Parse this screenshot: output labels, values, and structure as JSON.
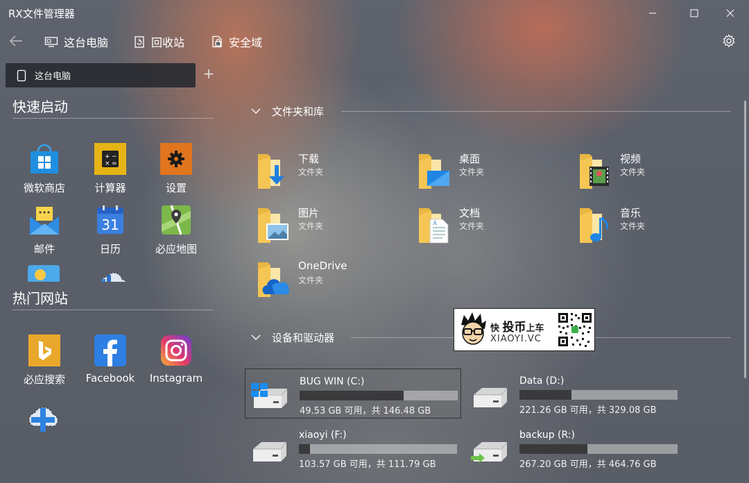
{
  "window": {
    "title": "RX文件管理器"
  },
  "toolbar": {
    "this_pc": "这台电脑",
    "recycle_bin": "回收站",
    "secure_zone": "安全域"
  },
  "tabs": [
    {
      "label": "这台电脑"
    }
  ],
  "sidebar": {
    "quick_launch_title": "快速启动",
    "apps": [
      {
        "label": "微软商店",
        "icon": "store-icon"
      },
      {
        "label": "计算器",
        "icon": "calculator-icon"
      },
      {
        "label": "设置",
        "icon": "settings-icon"
      },
      {
        "label": "邮件",
        "icon": "mail-icon"
      },
      {
        "label": "日历",
        "icon": "calendar-icon"
      },
      {
        "label": "必应地图",
        "icon": "maps-icon"
      }
    ],
    "calendar_day": "31",
    "hot_sites_title": "热门网站",
    "sites": [
      {
        "label": "必应搜索",
        "icon": "bing-icon"
      },
      {
        "label": "Facebook",
        "icon": "facebook-icon"
      },
      {
        "label": "Instagram",
        "icon": "instagram-icon"
      }
    ]
  },
  "main": {
    "folders_title": "文件夹和库",
    "folders": [
      {
        "name": "下载",
        "sub": "文件夹"
      },
      {
        "name": "桌面",
        "sub": "文件夹"
      },
      {
        "name": "视频",
        "sub": "文件夹"
      },
      {
        "name": "图片",
        "sub": "文件夹"
      },
      {
        "name": "文档",
        "sub": "文件夹"
      },
      {
        "name": "音乐",
        "sub": "文件夹"
      },
      {
        "name": "OneDrive",
        "sub": "文件夹"
      }
    ],
    "drives_title": "设备和驱动器",
    "drives": [
      {
        "name": "BUG WIN (C:)",
        "info": "49.53 GB 可用，共 146.48 GB",
        "used_fraction": 0.66
      },
      {
        "name": "Data (D:)",
        "info": "221.26 GB 可用，共 329.08 GB",
        "used_fraction": 0.33
      },
      {
        "name": "xiaoyi (F:)",
        "info": "103.57 GB 可用，共 111.79 GB",
        "used_fraction": 0.07
      },
      {
        "name": "backup (R:)",
        "info": "267.20 GB 可用，共 464.76 GB",
        "used_fraction": 0.43
      }
    ]
  },
  "watermark": {
    "brand_prefix": "快",
    "brand_main": "投币",
    "brand_suffix": "上车",
    "site": "XIAOYI.VC"
  },
  "colors": {
    "folder": "#f5c654",
    "accent": "#0a84ff",
    "drive_fill": "#3a3a3c"
  }
}
